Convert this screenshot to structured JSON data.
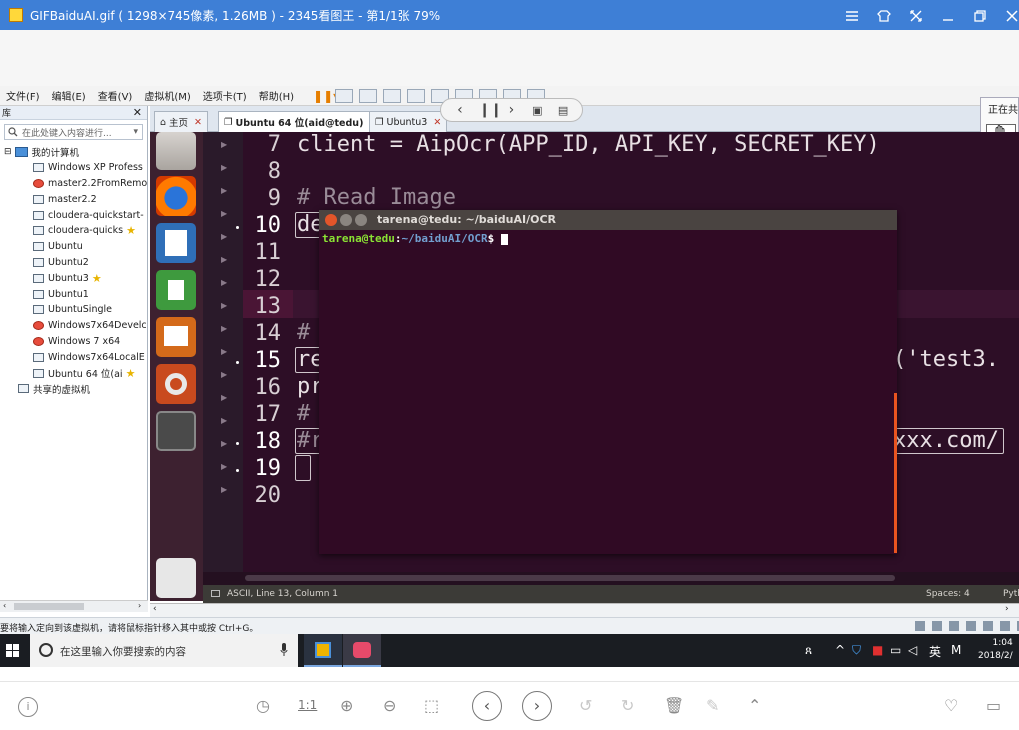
{
  "viewer": {
    "title": "GIFBaiduAI.gif ( 1298×745像素, 1.26MB ) - 2345看图王 - 第1/1张 79%",
    "window_buttons": [
      "menu-icon",
      "skin-icon",
      "fullscreen-icon",
      "minimize-icon",
      "restore-icon",
      "close-icon"
    ],
    "ratio_label": "1:1"
  },
  "vmware": {
    "menu": [
      "文件(F)",
      "编辑(E)",
      "查看(V)",
      "虚拟机(M)",
      "选项卡(T)",
      "帮助(H)"
    ],
    "library": {
      "title": "库",
      "search_placeholder": "在此处键入内容进行...",
      "root": "我的计算机",
      "items": [
        {
          "name": "Windows XP Profess",
          "status": "normal",
          "star": false
        },
        {
          "name": "master2.2FromRemo",
          "status": "error",
          "star": false
        },
        {
          "name": "master2.2",
          "status": "normal",
          "star": false
        },
        {
          "name": "cloudera-quickstart-",
          "status": "normal",
          "star": false
        },
        {
          "name": "cloudera-quicks",
          "status": "normal",
          "star": true
        },
        {
          "name": "Ubuntu",
          "status": "normal",
          "star": false
        },
        {
          "name": "Ubuntu2",
          "status": "normal",
          "star": false
        },
        {
          "name": "Ubuntu3",
          "status": "normal",
          "star": true
        },
        {
          "name": "Ubuntu1",
          "status": "normal",
          "star": false
        },
        {
          "name": "UbuntuSingle",
          "status": "normal",
          "star": false
        },
        {
          "name": "Windows7x64Develc",
          "status": "error",
          "star": false
        },
        {
          "name": "Windows 7 x64",
          "status": "error",
          "star": false
        },
        {
          "name": "Windows7x64LocalE",
          "status": "normal",
          "star": false
        },
        {
          "name": "Ubuntu 64 位(ai",
          "status": "normal",
          "star": true
        }
      ],
      "shared": "共享的虚拟机"
    },
    "tabs": [
      {
        "label": "主页",
        "active": false
      },
      {
        "label": "Ubuntu 64 位(aid@tedu)",
        "active": true
      },
      {
        "label": "Ubuntu3",
        "active": false
      }
    ],
    "side_panel_label": "正在共",
    "status_text": "要将输入定向到该虚拟机，请将鼠标指针移入其中或按 Ctrl+G。"
  },
  "editor": {
    "line_numbers": [
      {
        "n": "7",
        "mod": false
      },
      {
        "n": "8",
        "mod": false
      },
      {
        "n": "9",
        "mod": false
      },
      {
        "n": "10",
        "mod": true
      },
      {
        "n": "11",
        "mod": false
      },
      {
        "n": "12",
        "mod": false
      },
      {
        "n": "13",
        "mod": false
      },
      {
        "n": "14",
        "mod": false
      },
      {
        "n": "15",
        "mod": true
      },
      {
        "n": "16",
        "mod": false
      },
      {
        "n": "17",
        "mod": false
      },
      {
        "n": "18",
        "mod": true
      },
      {
        "n": "19",
        "mod": true
      },
      {
        "n": "20",
        "mod": false
      }
    ],
    "code": {
      "l7": "client = AipOcr(APP_ID, API_KEY, SECRET_KEY)",
      "l9": "# Read Image",
      "l10": "de",
      "l14": "#",
      "l15_left": "re",
      "l15_right": "('test3.",
      "l16": "pr",
      "l17": "#",
      "l18_left": "#r",
      "l18_right": "xxx.com/"
    },
    "status_left": "ASCII, Line 13, Column 1",
    "status_spaces": "Spaces: 4",
    "status_syntax": "Pyth"
  },
  "terminal": {
    "title": "tarena@tedu: ~/baiduAI/OCR",
    "prompt_user": "tarena@tedu",
    "prompt_sep": ":",
    "prompt_path": "~/baiduAI/OCR",
    "prompt_sign": "$"
  },
  "taskbar": {
    "search_placeholder": "在这里输入你要搜索的内容",
    "ime": "英",
    "ime_mode": "M",
    "time": "1:04",
    "date": "2018/2/"
  },
  "colors": {
    "viewer_titlebar": "#3e7fd6",
    "ubuntu_bg": "#2c001e",
    "terminal_bg": "#300a24",
    "prompt_green": "#8ae234",
    "prompt_blue": "#729fcf",
    "ubuntu_orange": "#e95420"
  }
}
